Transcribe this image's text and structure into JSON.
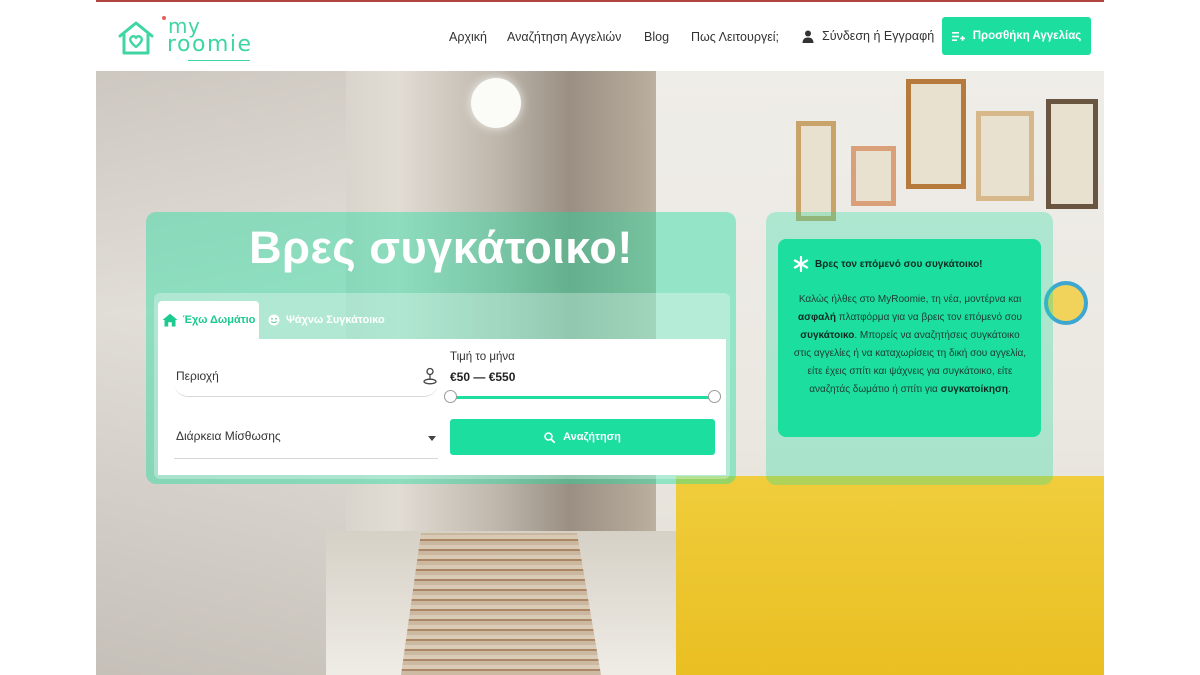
{
  "brand": {
    "my": "my",
    "roomie": "roomie"
  },
  "nav": {
    "home": "Αρχική",
    "search_listings": "Αναζήτηση Αγγελιών",
    "blog": "Blog",
    "how_it_works": "Πως Λειτουργεί;",
    "login": "Σύνδεση ή Εγγραφή",
    "add_listing": "Προσθήκη Αγγελίας"
  },
  "hero": {
    "title": "Βρες συγκάτοικο!"
  },
  "search": {
    "tabs": [
      {
        "label": "Έχω Δωμάτιο",
        "active": true
      },
      {
        "label": "Ψάχνω Συγκάτοικο",
        "active": false
      }
    ],
    "area_label": "Περιοχή",
    "price_label": "Τιμή το μήνα",
    "price_value": "€50 — €550",
    "price_range": [
      50,
      550
    ],
    "duration_label": "Διάρκεια Μίσθωσης",
    "button_label": "Αναζήτηση"
  },
  "info": {
    "heading": "Βρες τον επόμενό σου συγκάτοικο!",
    "body_part1": "Καλώς ήλθες στο MyRoomie, τη νέα, μοντέρνα και ",
    "body_bold1": "ασφαλή",
    "body_part2": " πλατφόρμα για να βρεις τον επόμενό σου ",
    "body_bold2": "συγκάτοικο",
    "body_part3": ". Μπορείς να αναζητήσεις συγκάτοικο στις αγγελίες ή να καταχωρίσεις τη δική σου αγγελία, είτε έχεις σπίτι και ψάχνεις για συγκάτοικο, είτε αναζητάς δωμάτιο ή σπίτι για ",
    "body_bold3": "συγκατοίκηση",
    "body_part4": "."
  },
  "colors": {
    "accent": "#1cde9f",
    "logo": "#3fd6a3",
    "top_border": "#b0443f"
  },
  "icons": {
    "logo": "house-heart-icon",
    "login": "user-icon",
    "add_listing": "list-plus-icon",
    "tab_room": "home-icon",
    "tab_roommate": "smile-icon",
    "area": "location-pin-icon",
    "duration": "chevron-down-icon",
    "search": "search-icon",
    "info": "asterisk-icon"
  }
}
